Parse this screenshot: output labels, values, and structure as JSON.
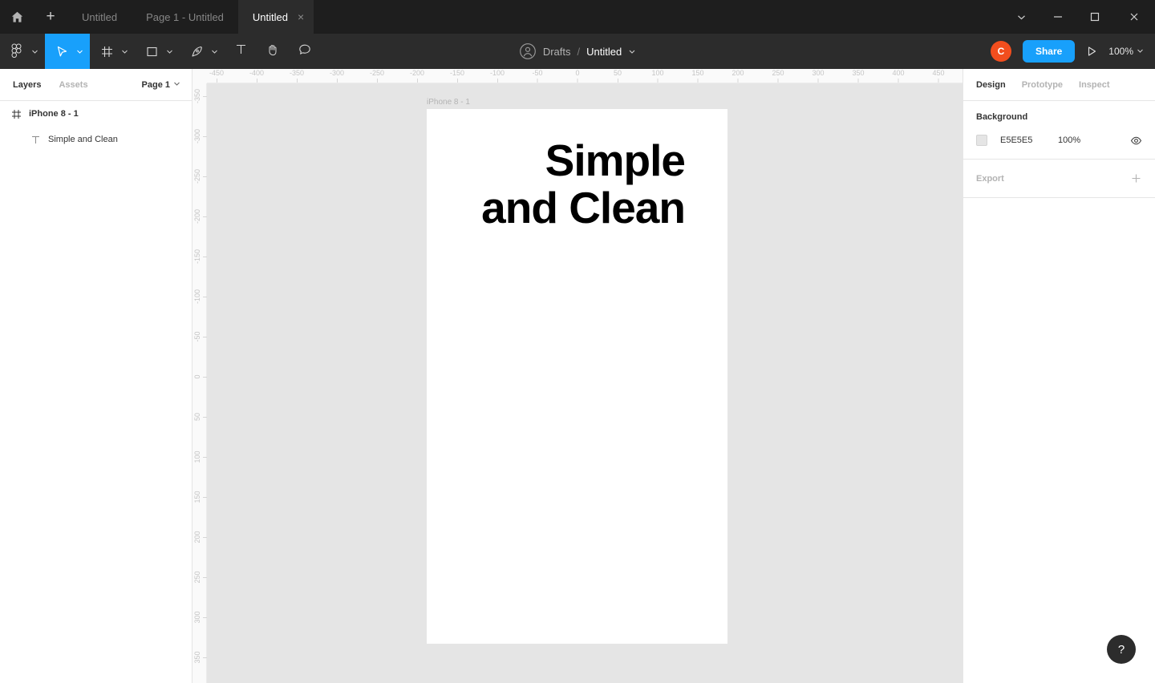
{
  "titlebar": {
    "home_icon": "home-icon",
    "new_tab_label": "+",
    "tabs": [
      {
        "label": "Untitled",
        "active": false,
        "closable": false
      },
      {
        "label": "Page 1 - Untitled",
        "active": false,
        "closable": false
      },
      {
        "label": "Untitled",
        "active": true,
        "closable": true
      }
    ],
    "close_glyph": "×",
    "window_controls": [
      {
        "name": "chevron-down-icon",
        "glyph": "chevron"
      },
      {
        "name": "minimize-button",
        "glyph": "minimize"
      },
      {
        "name": "maximize-button",
        "glyph": "maximize"
      },
      {
        "name": "close-window-button",
        "glyph": "close"
      }
    ]
  },
  "toolbar": {
    "tools": [
      {
        "name": "figma-menu",
        "icon": "figma-logo-icon",
        "caret": true,
        "selected": false
      },
      {
        "name": "move-tool",
        "icon": "cursor-arrow-icon",
        "caret": true,
        "selected": true
      },
      {
        "name": "frame-tool",
        "icon": "frame-icon",
        "caret": true,
        "selected": false
      },
      {
        "name": "shape-tool",
        "icon": "rectangle-icon",
        "caret": true,
        "selected": false
      },
      {
        "name": "pen-tool",
        "icon": "pen-icon",
        "caret": true,
        "selected": false
      },
      {
        "name": "text-tool",
        "icon": "text-icon",
        "caret": false,
        "selected": false
      },
      {
        "name": "hand-tool",
        "icon": "hand-icon",
        "caret": false,
        "selected": false
      },
      {
        "name": "comment-tool",
        "icon": "comment-icon",
        "caret": false,
        "selected": false
      }
    ],
    "breadcrumb": {
      "avatar_icon": "user-circle-icon",
      "project": "Drafts",
      "separator": "/",
      "file_name": "Untitled",
      "caret_icon": "chevron-down-icon"
    },
    "avatar_initial": "C",
    "avatar_color": "#F24E1E",
    "share_label": "Share",
    "share_color": "#18A0FB",
    "present_icon": "play-icon",
    "zoom_level": "100%",
    "zoom_caret_icon": "chevron-down-icon"
  },
  "left_panel": {
    "tabs": [
      {
        "label": "Layers",
        "active": true
      },
      {
        "label": "Assets",
        "active": false
      }
    ],
    "page_selector": "Page 1",
    "page_caret_icon": "chevron-down-icon",
    "layers": [
      {
        "name": "iPhone 8 - 1",
        "icon": "frame-icon",
        "depth": 0
      },
      {
        "name": "Simple and Clean",
        "icon": "text-icon",
        "depth": 1
      }
    ]
  },
  "canvas": {
    "background_color": "#E5E5E5",
    "ruler_h_labels": [
      "-450",
      "-400",
      "-350",
      "-300",
      "-250",
      "-200",
      "-150",
      "-100",
      "-50",
      "0",
      "50",
      "100",
      "150",
      "200",
      "250",
      "300",
      "350",
      "400",
      "450"
    ],
    "ruler_v_labels": [
      "-350",
      "-300",
      "-250",
      "-200",
      "-150",
      "-100",
      "-50",
      "0",
      "50",
      "100",
      "150",
      "200",
      "250",
      "300",
      "350"
    ],
    "frame_label": "iPhone 8 - 1",
    "artboard": {
      "fill": "#FFFFFF",
      "text": "Simple and Clean"
    }
  },
  "right_panel": {
    "tabs": [
      {
        "label": "Design",
        "active": true
      },
      {
        "label": "Prototype",
        "active": false
      },
      {
        "label": "Inspect",
        "active": false
      }
    ],
    "background": {
      "title": "Background",
      "color_hex": "E5E5E5",
      "color_value": "#E5E5E5",
      "opacity": "100%",
      "visibility_icon": "eye-icon"
    },
    "export": {
      "title": "Export",
      "add_icon": "plus-icon"
    }
  },
  "help": {
    "label": "?"
  }
}
